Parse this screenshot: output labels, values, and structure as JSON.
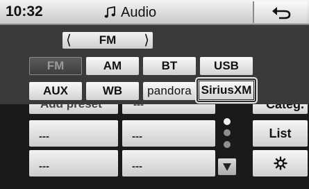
{
  "header": {
    "time": "10:32",
    "title": "Audio",
    "title_icon": "music-note-icon",
    "back_icon": "back-arrow-icon"
  },
  "band_selector": {
    "value": "FM",
    "prev_icon": "chevron-left-icon",
    "next_icon": "chevron-right-icon"
  },
  "sources": {
    "row1": [
      "FM",
      "AM",
      "BT",
      "USB"
    ],
    "row2": [
      "AUX",
      "WB",
      "pandora",
      "SiriusXM"
    ],
    "selected": "SiriusXM",
    "disabled": "FM"
  },
  "presets": {
    "top_left": "Add preset",
    "top_mid": "---",
    "items": [
      "---",
      "---",
      "---",
      "---"
    ]
  },
  "side": {
    "top_label": "Categ.",
    "list_label": "List",
    "settings_icon": "gear-icon",
    "scroll_down_icon": "triangle-down-icon"
  }
}
